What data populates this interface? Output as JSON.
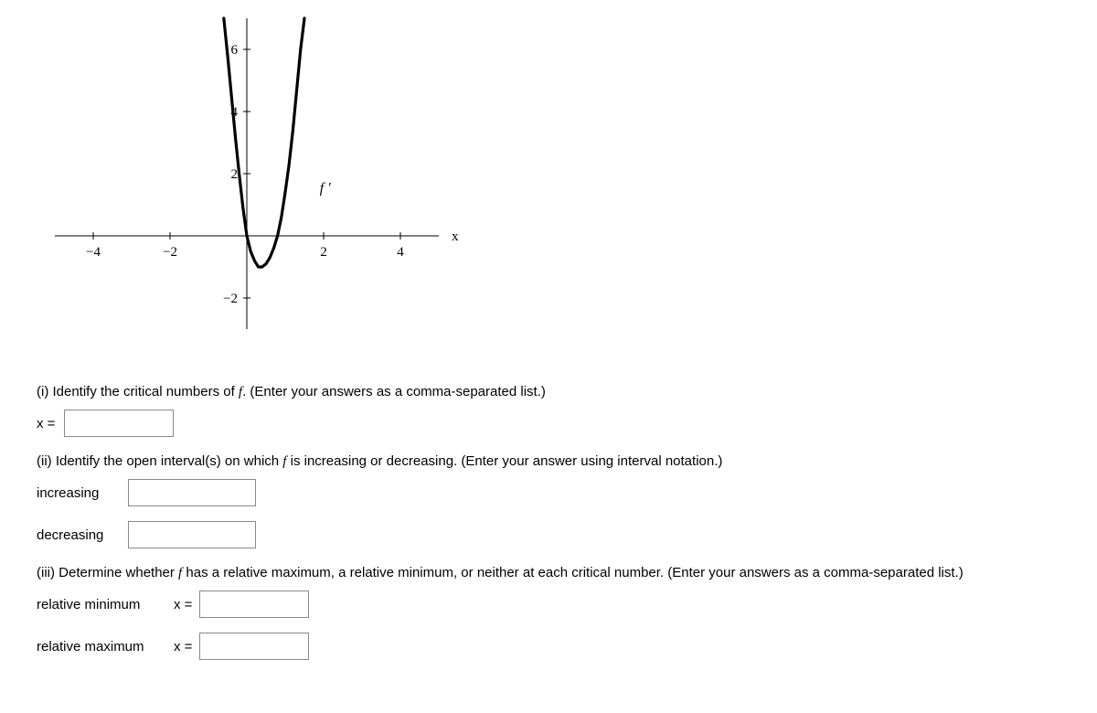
{
  "chart_data": {
    "type": "line",
    "title": "",
    "series_label": "f '",
    "x_axis_label": "x",
    "x_ticks": [
      -4,
      -2,
      2,
      4
    ],
    "y_ticks": [
      -2,
      2,
      4,
      6
    ],
    "xlim": [
      -5,
      5
    ],
    "ylim": [
      -3,
      7
    ],
    "series": [
      {
        "name": "f '",
        "points": [
          {
            "x": -0.6,
            "y": 7.0
          },
          {
            "x": -0.5,
            "y": 5.8
          },
          {
            "x": -0.4,
            "y": 4.5
          },
          {
            "x": -0.3,
            "y": 3.2
          },
          {
            "x": -0.2,
            "y": 2.0
          },
          {
            "x": -0.1,
            "y": 0.9
          },
          {
            "x": 0.0,
            "y": 0.0
          },
          {
            "x": 0.1,
            "y": -0.5
          },
          {
            "x": 0.2,
            "y": -0.8
          },
          {
            "x": 0.3,
            "y": -1.0
          },
          {
            "x": 0.4,
            "y": -1.0
          },
          {
            "x": 0.5,
            "y": -0.9
          },
          {
            "x": 0.6,
            "y": -0.7
          },
          {
            "x": 0.7,
            "y": -0.4
          },
          {
            "x": 0.8,
            "y": 0.0
          },
          {
            "x": 0.9,
            "y": 0.6
          },
          {
            "x": 1.0,
            "y": 1.4
          },
          {
            "x": 1.1,
            "y": 2.3
          },
          {
            "x": 1.2,
            "y": 3.4
          },
          {
            "x": 1.3,
            "y": 4.7
          },
          {
            "x": 1.4,
            "y": 6.0
          },
          {
            "x": 1.5,
            "y": 7.0
          }
        ]
      }
    ]
  },
  "q1": {
    "prompt_pre": "(i) Identify the critical numbers of ",
    "prompt_f": "f",
    "prompt_post": ". (Enter your answers as a comma-separated list.)",
    "label": "x ="
  },
  "q2": {
    "prompt_pre": "(ii) Identify the open interval(s) on which ",
    "prompt_f": "f",
    "prompt_post": " is increasing or decreasing. (Enter your answer using interval notation.)",
    "label_inc": "increasing",
    "label_dec": "decreasing"
  },
  "q3": {
    "prompt_pre": "(iii) Determine whether ",
    "prompt_f": "f",
    "prompt_post": " has a relative maximum, a relative minimum, or neither at each critical number. (Enter your answers as a comma-separated list.)",
    "label_min": "relative minimum",
    "label_max": "relative maximum",
    "xeq": "x ="
  }
}
